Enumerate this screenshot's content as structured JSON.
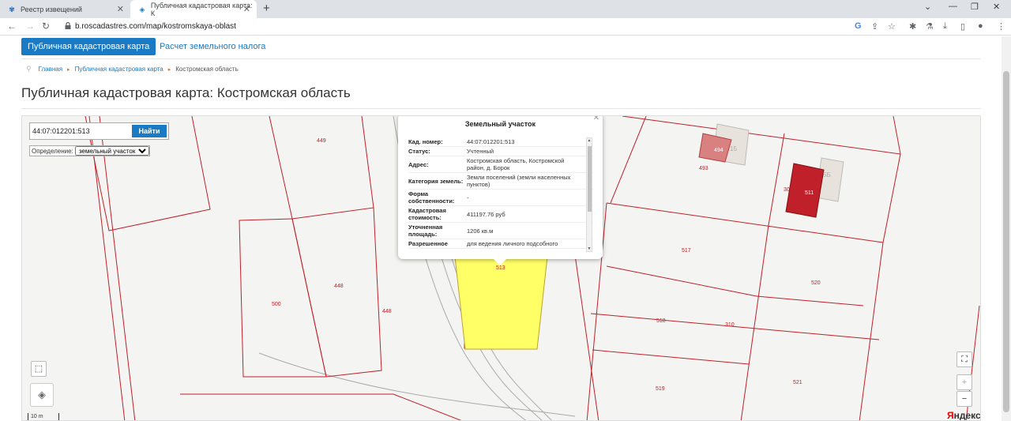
{
  "browser": {
    "tabs": [
      {
        "title": "Реестр извещений",
        "active": false
      },
      {
        "title": "Публичная кадастровая карта: К",
        "active": true
      }
    ],
    "url": "b.roscadastres.com/map/kostromskaya-oblast"
  },
  "header": {
    "primary_button": "Публичная кадастровая карта",
    "secondary_link": "Расчет земельного налога"
  },
  "breadcrumb": [
    "Главная",
    "Публичная кадастровая карта",
    "Костромская область"
  ],
  "page_title": "Публичная кадастровая карта: Костромская область",
  "map": {
    "search": {
      "value": "44:07:012201:513",
      "button": "Найти"
    },
    "definition_label": "Определение:",
    "definition_value": "земельный участок",
    "scale_label": "10 m",
    "provider": {
      "first": "Я",
      "rest": "ндекс"
    },
    "parcel_labels": [
      "449",
      "448",
      "448",
      "500",
      "493",
      "513",
      "517",
      "518",
      "310",
      "519",
      "520",
      "521",
      "300",
      "494",
      "15",
      "511",
      "5Б"
    ],
    "zoom_in": "+",
    "zoom_out": "−"
  },
  "popup": {
    "title": "Земельный участок",
    "rows": [
      {
        "key": "Кад. номер:",
        "value": "44:07:012201:513"
      },
      {
        "key": "Статус:",
        "value": "Учтенный"
      },
      {
        "key": "Адрес:",
        "value": "Костромская область, Костромской район, д. Борок"
      },
      {
        "key": "Категория земель:",
        "value": "Земли поселений (земли населенных пунктов)"
      },
      {
        "key": "Форма собственности:",
        "value": "-"
      },
      {
        "key": "Кадастровая стоимость:",
        "value": "411197.76 руб"
      },
      {
        "key": "Уточненная площадь:",
        "value": "1206 кв.м"
      },
      {
        "key": "Разрешенное",
        "value": "для ведения личного подсобного"
      }
    ]
  }
}
